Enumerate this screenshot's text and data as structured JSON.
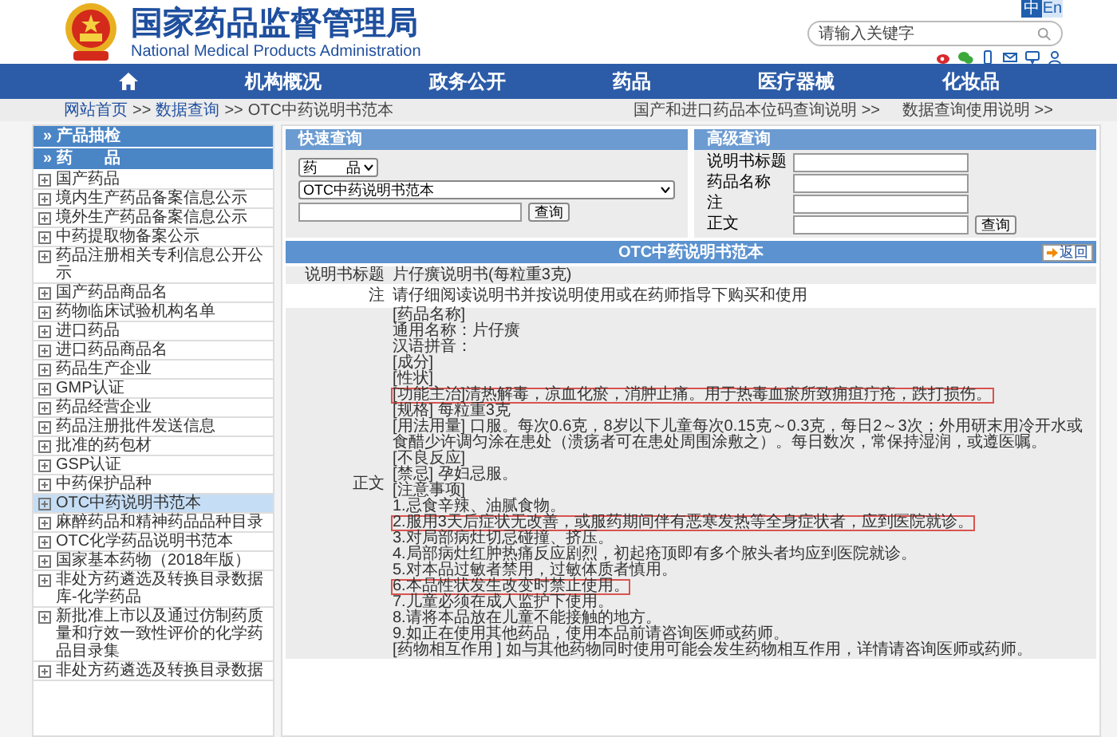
{
  "header": {
    "title": "国家药品监督管理局",
    "subtitle": "National Medical Products Administration",
    "languages": [
      {
        "label": "中",
        "selected": true
      },
      {
        "label": "En",
        "selected": false
      }
    ],
    "search": {
      "placeholder": "请输入关键字"
    }
  },
  "nav": [
    {
      "kind": "home"
    },
    {
      "kind": "text",
      "label": "机构概况"
    },
    {
      "kind": "text",
      "label": "政务公开"
    },
    {
      "kind": "text",
      "label": "药品"
    },
    {
      "kind": "text",
      "label": "医疗器械"
    },
    {
      "kind": "text",
      "label": "化妆品"
    }
  ],
  "breadcrumb": {
    "separator": ">>",
    "links": [
      "网站首页",
      "数据查询"
    ],
    "current": "OTC中药说明书范本",
    "right_links": [
      "国产和进口药品本位码查询说明 >>",
      "数据查询使用说明 >>"
    ]
  },
  "sidebar": {
    "headers": [
      "» 产品抽检",
      "» 药　　品"
    ],
    "items": [
      {
        "label": "国产药品",
        "selected": false
      },
      {
        "label": "境内生产药品备案信息公示",
        "selected": false
      },
      {
        "label": "境外生产药品备案信息公示",
        "selected": false
      },
      {
        "label": "中药提取物备案公示",
        "selected": false
      },
      {
        "label": "药品注册相关专利信息公开公示",
        "selected": false
      },
      {
        "label": "国产药品商品名",
        "selected": false
      },
      {
        "label": "药物临床试验机构名单",
        "selected": false
      },
      {
        "label": "进口药品",
        "selected": false
      },
      {
        "label": "进口药品商品名",
        "selected": false
      },
      {
        "label": "药品生产企业",
        "selected": false
      },
      {
        "label": "GMP认证",
        "selected": false
      },
      {
        "label": "药品经营企业",
        "selected": false
      },
      {
        "label": "药品注册批件发送信息",
        "selected": false
      },
      {
        "label": "批准的药包材",
        "selected": false
      },
      {
        "label": "GSP认证",
        "selected": false
      },
      {
        "label": "中药保护品种",
        "selected": false
      },
      {
        "label": "OTC中药说明书范本",
        "selected": true
      },
      {
        "label": "麻醉药品和精神药品品种目录",
        "selected": false
      },
      {
        "label": "OTC化学药品说明书范本",
        "selected": false
      },
      {
        "label": "国家基本药物（2018年版）",
        "selected": false
      },
      {
        "label": "非处方药遴选及转换目录数据库-化学药品",
        "selected": false
      },
      {
        "label": "新批准上市以及通过仿制药质量和疗效一致性评价的化学药品目录集",
        "selected": false
      },
      {
        "label": "非处方药遴选及转换目录数据",
        "selected": false
      }
    ]
  },
  "quick_query": {
    "title": "快速查询",
    "category": "药　　品",
    "database": "OTC中药说明书范本",
    "button": "查询"
  },
  "advanced_query": {
    "title": "高级查询",
    "fields": [
      "说明书标题",
      "药品名称",
      "注",
      "正文"
    ],
    "button": "查询"
  },
  "result": {
    "title": "OTC中药说明书范本",
    "back_button": "返回",
    "rows": [
      {
        "label": "说明书标题",
        "lines": [
          {
            "text": "片仔癀说明书(每粒重3克)",
            "boxed": false
          }
        ]
      },
      {
        "label": "注",
        "lines": [
          {
            "text": "请仔细阅读说明书并按说明使用或在药师指导下购买和使用",
            "boxed": false
          }
        ]
      },
      {
        "label": "正文",
        "lines": [
          {
            "text": "[药品名称]",
            "boxed": false
          },
          {
            "text": "通用名称：片仔癀",
            "boxed": false
          },
          {
            "text": "汉语拼音：",
            "boxed": false
          },
          {
            "text": "[成分]",
            "boxed": false
          },
          {
            "text": "[性状]",
            "boxed": false
          },
          {
            "text": "[功能主治]清热解毒，凉血化瘀，消肿止痛。用于热毒血瘀所致痈疽疔疮，跌打损伤。",
            "boxed": true
          },
          {
            "text": "[规格] 每粒重3克",
            "boxed": false
          },
          {
            "text": "[用法用量] 口服。每次0.6克，8岁以下儿童每次0.15克～0.3克，每日2～3次；外用研末用冷开水或食醋少许调匀涂在患处（溃疡者可在患处周围涂敷之）。每日数次，常保持湿润，或遵医嘱。",
            "boxed": false
          },
          {
            "text": "[不良反应]",
            "boxed": false
          },
          {
            "text": "[禁忌] 孕妇忌服。",
            "boxed": false
          },
          {
            "text": "[注意事项]",
            "boxed": false
          },
          {
            "text": "1.忌食辛辣、油腻食物。",
            "boxed": false
          },
          {
            "text": "2.服用3天后症状无改善，或服药期间伴有恶寒发热等全身症状者，应到医院就诊。",
            "boxed": true
          },
          {
            "text": "3.对局部病灶切忌碰撞、挤压。",
            "boxed": false
          },
          {
            "text": "4.局部病灶红肿热痛反应剧烈，初起疮顶即有多个脓头者均应到医院就诊。",
            "boxed": false
          },
          {
            "text": "5.对本品过敏者禁用，过敏体质者慎用。",
            "boxed": false
          },
          {
            "text": "6.本品性状发生改变时禁止使用。",
            "boxed": true
          },
          {
            "text": "7.儿童必须在成人监护下使用。",
            "boxed": false
          },
          {
            "text": "8.请将本品放在儿童不能接触的地方。",
            "boxed": false
          },
          {
            "text": "9.如正在使用其他药品，使用本品前请咨询医师或药师。",
            "boxed": false
          },
          {
            "text": "[药物相互作用 ] 如与其他药物同时使用可能会发生药物相互作用，详情请咨询医师或药师。",
            "boxed": false
          }
        ]
      }
    ]
  }
}
